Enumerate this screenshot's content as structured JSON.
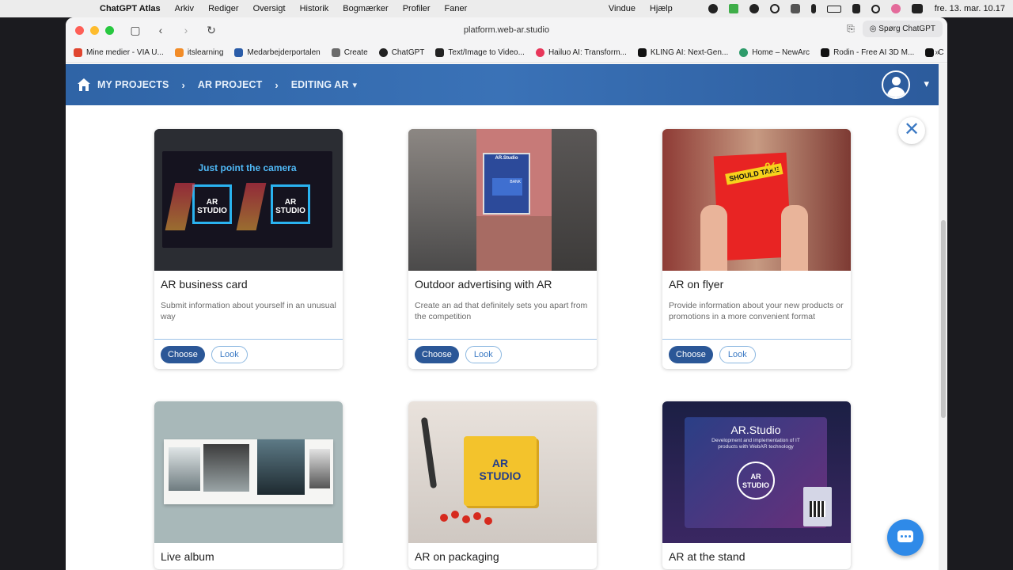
{
  "menubar": {
    "app_name": "ChatGPT Atlas",
    "items": [
      "Arkiv",
      "Rediger",
      "Oversigt",
      "Historik",
      "Bogmærker",
      "Profiler",
      "Faner"
    ],
    "right_items": [
      "Vindue",
      "Hjælp"
    ],
    "clock": "fre. 13. mar.  10.17"
  },
  "browser": {
    "url": "platform.web-ar.studio",
    "ask_label": "Spørg ChatGPT",
    "bookmarks": [
      {
        "label": "Mine medier - VIA U...",
        "color": "#e0452f"
      },
      {
        "label": "itslearning",
        "color": "#f28c28"
      },
      {
        "label": "Medarbejderportalen",
        "color": "#2a5ca8"
      },
      {
        "label": "Create",
        "color": "#6b6b6b"
      },
      {
        "label": "ChatGPT",
        "color": "#222222"
      },
      {
        "label": "Text/Image to Video...",
        "color": "#222222"
      },
      {
        "label": "Hailuo AI: Transform...",
        "color": "#e8375a"
      },
      {
        "label": "KLING AI: Next-Gen...",
        "color": "#111111"
      },
      {
        "label": "Home – NewArc",
        "color": "#2e9b6a"
      },
      {
        "label": "Rodin - Free AI 3D M...",
        "color": "#111111"
      },
      {
        "label": "C",
        "color": "#111111"
      }
    ],
    "bookmarks_more": "»"
  },
  "header": {
    "breadcrumbs": [
      "MY PROJECTS",
      "AR PROJECT",
      "EDITING AR"
    ]
  },
  "close_label": "✕",
  "cards": [
    {
      "title": "AR business card",
      "description": "Submit information about yourself in an unusual way",
      "choose_label": "Choose",
      "look_label": "Look",
      "image_text": "Just point the camera",
      "image_logo": "AR STUDIO"
    },
    {
      "title": "Outdoor advertising with AR",
      "description": "Create an ad that definitely sets you apart from the competition",
      "choose_label": "Choose",
      "look_label": "Look",
      "image_text": "AR.Studio",
      "image_logo": "BANK"
    },
    {
      "title": "AR on flyer",
      "description": "Provide information about your new products or promotions in a more convenient format",
      "choose_label": "Choose",
      "look_label": "Look",
      "image_text": "SHOULD TAKE",
      "image_logo": "%"
    },
    {
      "title": "Live album",
      "description": "",
      "choose_label": "",
      "look_label": "",
      "image_text": "",
      "image_logo": ""
    },
    {
      "title": "AR on packaging",
      "description": "",
      "choose_label": "",
      "look_label": "",
      "image_text": "",
      "image_logo": "AR STUDIO"
    },
    {
      "title": "AR at the stand",
      "description": "",
      "choose_label": "",
      "look_label": "",
      "image_text": "AR.Studio",
      "image_subtext": "Development and implementation of IT products with WebAR technology",
      "image_logo": "AR STUDIO"
    }
  ],
  "colors": {
    "header_start": "#2f64a6",
    "header_end": "#2c5b9c",
    "choose_bg": "#2b5797",
    "look_border": "#8bb7e0",
    "chat_fab": "#2f8ae8"
  }
}
